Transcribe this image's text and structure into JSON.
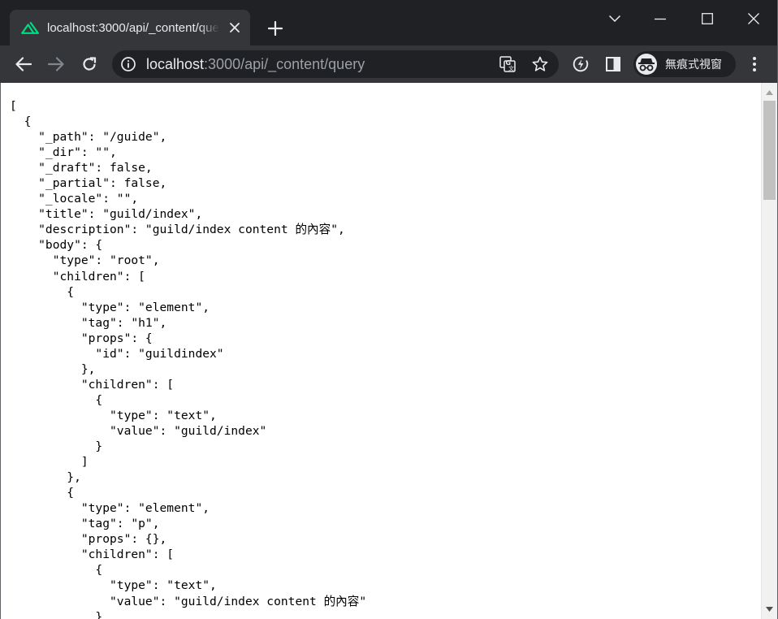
{
  "colors": {
    "nuxt_green": "#00DC82",
    "tab_active": "#35363a",
    "frame": "#202124",
    "text": "#e8eaed",
    "muted": "#9aa0a6"
  },
  "tab": {
    "title": "localhost:3000/api/_content/query",
    "favicon": "nuxt-logo-icon"
  },
  "address_bar": {
    "host": "localhost",
    "path": ":3000/api/_content/query"
  },
  "incognito": {
    "label": "無痕式視窗"
  },
  "json_lines": [
    "[",
    "  {",
    "    \"_path\": \"/guide\",",
    "    \"_dir\": \"\",",
    "    \"_draft\": false,",
    "    \"_partial\": false,",
    "    \"_locale\": \"\",",
    "    \"title\": \"guild/index\",",
    "    \"description\": \"guild/index content 的內容\",",
    "    \"body\": {",
    "      \"type\": \"root\",",
    "      \"children\": [",
    "        {",
    "          \"type\": \"element\",",
    "          \"tag\": \"h1\",",
    "          \"props\": {",
    "            \"id\": \"guildindex\"",
    "          },",
    "          \"children\": [",
    "            {",
    "              \"type\": \"text\",",
    "              \"value\": \"guild/index\"",
    "            }",
    "          ]",
    "        },",
    "        {",
    "          \"type\": \"element\",",
    "          \"tag\": \"p\",",
    "          \"props\": {},",
    "          \"children\": [",
    "            {",
    "              \"type\": \"text\",",
    "              \"value\": \"guild/index content 的內容\"",
    "            }"
  ]
}
